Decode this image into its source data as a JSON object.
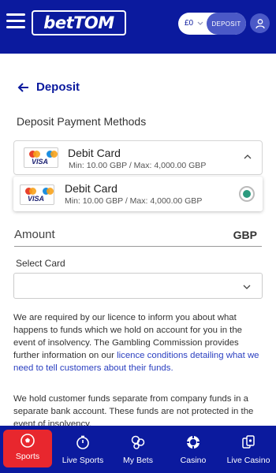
{
  "header": {
    "logo_text": "betTOM",
    "balance": "£0",
    "deposit_label": "DEPOSIT"
  },
  "page": {
    "back_title": "Deposit",
    "section_label": "Deposit Payment Methods"
  },
  "method_select": {
    "name": "Debit Card",
    "limits": "Min: 10.00 GBP / Max: 4,000.00 GBP",
    "card_logo_text": "VISA"
  },
  "method_option": {
    "name": "Debit Card",
    "limits": "Min: 10.00 GBP / Max: 4,000.00 GBP",
    "card_logo_text": "VISA",
    "selected": true
  },
  "amount": {
    "label": "Amount",
    "currency": "GBP"
  },
  "select_card": {
    "label": "Select Card",
    "value": ""
  },
  "info": {
    "p1_start": "We are required by our licence to inform you about what happens to funds which we hold on account for you in the event of insolvency. The Gambling Commission provides further information on our ",
    "p1_link": "licence conditions detailing what we need to tell customers about their funds.",
    "p2": "We hold customer funds separate from company funds in a separate bank account. These funds are not protected in the event of insolvency."
  },
  "bottom_nav": {
    "items": [
      {
        "label": "Sports",
        "icon": "soccer-ball-icon",
        "active": true
      },
      {
        "label": "Live Sports",
        "icon": "stopwatch-icon",
        "active": false
      },
      {
        "label": "My Bets",
        "icon": "bets-icon",
        "active": false
      },
      {
        "label": "Casino",
        "icon": "casino-chip-icon",
        "active": false
      },
      {
        "label": "Live Casino",
        "icon": "cards-icon",
        "active": false
      }
    ]
  },
  "colors": {
    "brand_blue": "#0b1a9e",
    "active_red": "#e8272e",
    "radio_green": "#2b9a7e",
    "link_blue": "#2a3fc0"
  }
}
